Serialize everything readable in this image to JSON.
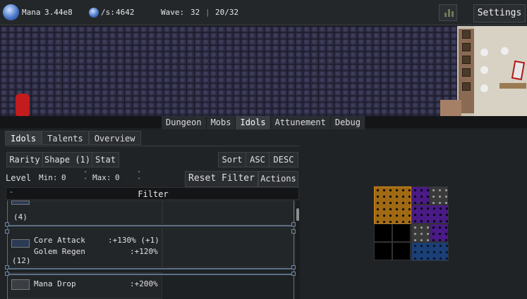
{
  "topbar": {
    "mana_label": "Mana",
    "mana_value": "3.44e8",
    "rate_label": "/s:",
    "rate_value": "4642",
    "wave_label": "Wave:",
    "wave_value": "32",
    "wave_sep": "|",
    "wave_progress": "20/32",
    "settings_label": "Settings",
    "icons": [
      "mana-orb-icon",
      "rate-orb-icon",
      "stats-chart-icon"
    ]
  },
  "nav_tabs": [
    {
      "label": "Dungeon",
      "active": false
    },
    {
      "label": "Mobs",
      "active": false
    },
    {
      "label": "Idols",
      "active": true
    },
    {
      "label": "Attunement",
      "active": false
    },
    {
      "label": "Debug",
      "active": false
    }
  ],
  "sub_tabs": [
    {
      "label": "Idols",
      "active": true
    },
    {
      "label": "Talents",
      "active": false
    },
    {
      "label": "Overview",
      "active": false
    }
  ],
  "filters": {
    "rarity": "Rarity",
    "shape": "Shape (1)",
    "stat": "Stat",
    "sort": "Sort",
    "asc": "ASC",
    "desc": "DESC",
    "level": "Level",
    "min_label": "Min:",
    "min_value": "0",
    "max_label": "Max:",
    "max_value": "0",
    "reset": "Reset Filter",
    "actions": "Actions",
    "filter_title": "Filter",
    "filter_toggle": "-"
  },
  "idols": [
    {
      "count": "(4)",
      "stats": []
    },
    {
      "count": "(12)",
      "stats": [
        {
          "name": "Core Attack",
          "value": ":+130% (+1)"
        },
        {
          "name": "Golem Regen",
          "value": ":+120%"
        }
      ]
    },
    {
      "count": "",
      "stats": [
        {
          "name": "Mana Drop",
          "value": ":+200%"
        }
      ]
    }
  ],
  "idol_grid": {
    "colors": {
      "orange": "#a06a14",
      "purple": "#4a1b86",
      "grey": "#3a3a3a",
      "blue": "#1b3f77",
      "empty": "#000000"
    }
  }
}
